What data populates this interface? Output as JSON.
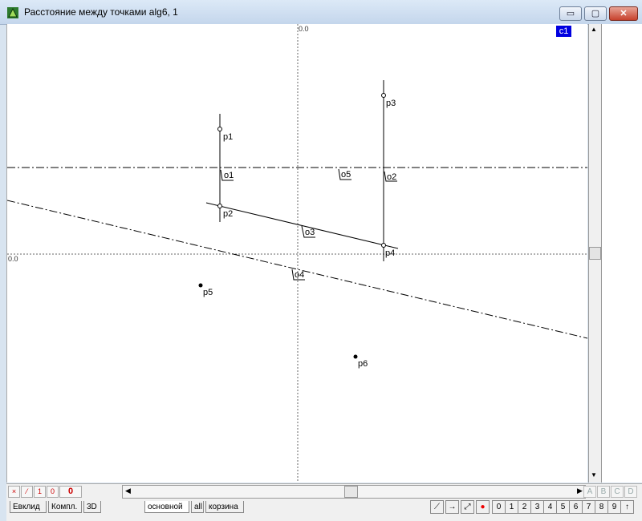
{
  "window": {
    "title": "Расстояние между точками alg6, 1",
    "minimize_glyph": "▭",
    "maximize_glyph": "▢",
    "close_glyph": "✕"
  },
  "canvas": {
    "layer_tag": "c1",
    "axis_label_top": "0.0",
    "axis_label_left": "0.0",
    "points": [
      "p1",
      "p2",
      "p3",
      "p4",
      "p5",
      "p6"
    ],
    "objects": [
      "o1",
      "o2",
      "o3",
      "o4",
      "o5"
    ]
  },
  "toolbar_left": {
    "btn_x": "×",
    "btn_line": "⁄",
    "btn_1": "1",
    "btn_0": "0",
    "counter": "0"
  },
  "scroll": {
    "left_arrow": "◀",
    "right_arrow": "▶",
    "up_arrow": "▲",
    "down_arrow": "▼"
  },
  "layer_buttons": [
    "A",
    "B",
    "C",
    "D"
  ],
  "tabs": [
    "Евклид",
    "Компл.",
    "3D",
    "основной",
    "all",
    "корзина"
  ],
  "bottom_buttons": {
    "tools": [
      "⟋",
      "→",
      "⤢",
      "●"
    ],
    "digits": [
      "0",
      "1",
      "2",
      "3",
      "4",
      "5",
      "6",
      "7",
      "8",
      "9",
      "↑"
    ]
  }
}
